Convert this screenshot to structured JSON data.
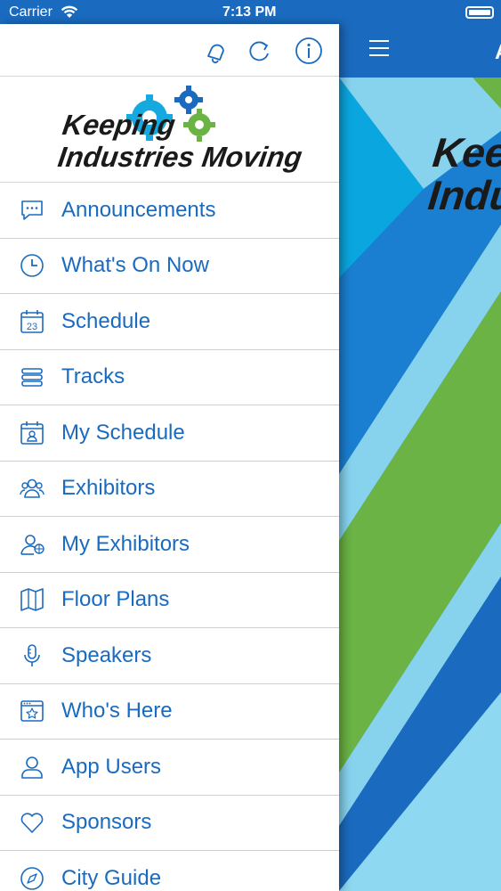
{
  "status_bar": {
    "carrier": "Carrier",
    "time": "7:13 PM"
  },
  "app": {
    "nav_title": "A",
    "banner_brand_line1": "Keep",
    "banner_brand_line2": "Indu"
  },
  "drawer": {
    "logo_line1": "Keeping",
    "logo_line2": "Industries Moving",
    "toolbar": [
      "notification-icon",
      "refresh-icon",
      "info-icon"
    ],
    "items": [
      {
        "label": "Announcements",
        "icon": "chat-icon"
      },
      {
        "label": "What's On Now",
        "icon": "clock-icon"
      },
      {
        "label": "Schedule",
        "icon": "calendar-icon"
      },
      {
        "label": "Tracks",
        "icon": "stack-icon"
      },
      {
        "label": "My Schedule",
        "icon": "my-schedule-icon"
      },
      {
        "label": "Exhibitors",
        "icon": "people-icon"
      },
      {
        "label": "My Exhibitors",
        "icon": "user-globe-icon"
      },
      {
        "label": "Floor Plans",
        "icon": "map-icon"
      },
      {
        "label": "Speakers",
        "icon": "microphone-icon"
      },
      {
        "label": "Who's Here",
        "icon": "browser-star-icon"
      },
      {
        "label": "App Users",
        "icon": "user-icon"
      },
      {
        "label": "Sponsors",
        "icon": "heart-icon"
      },
      {
        "label": "City Guide",
        "icon": "compass-icon"
      }
    ]
  },
  "colors": {
    "primary": "#1a6bbf",
    "accent_green": "#6ab344",
    "light_blue": "#87d3ee"
  }
}
